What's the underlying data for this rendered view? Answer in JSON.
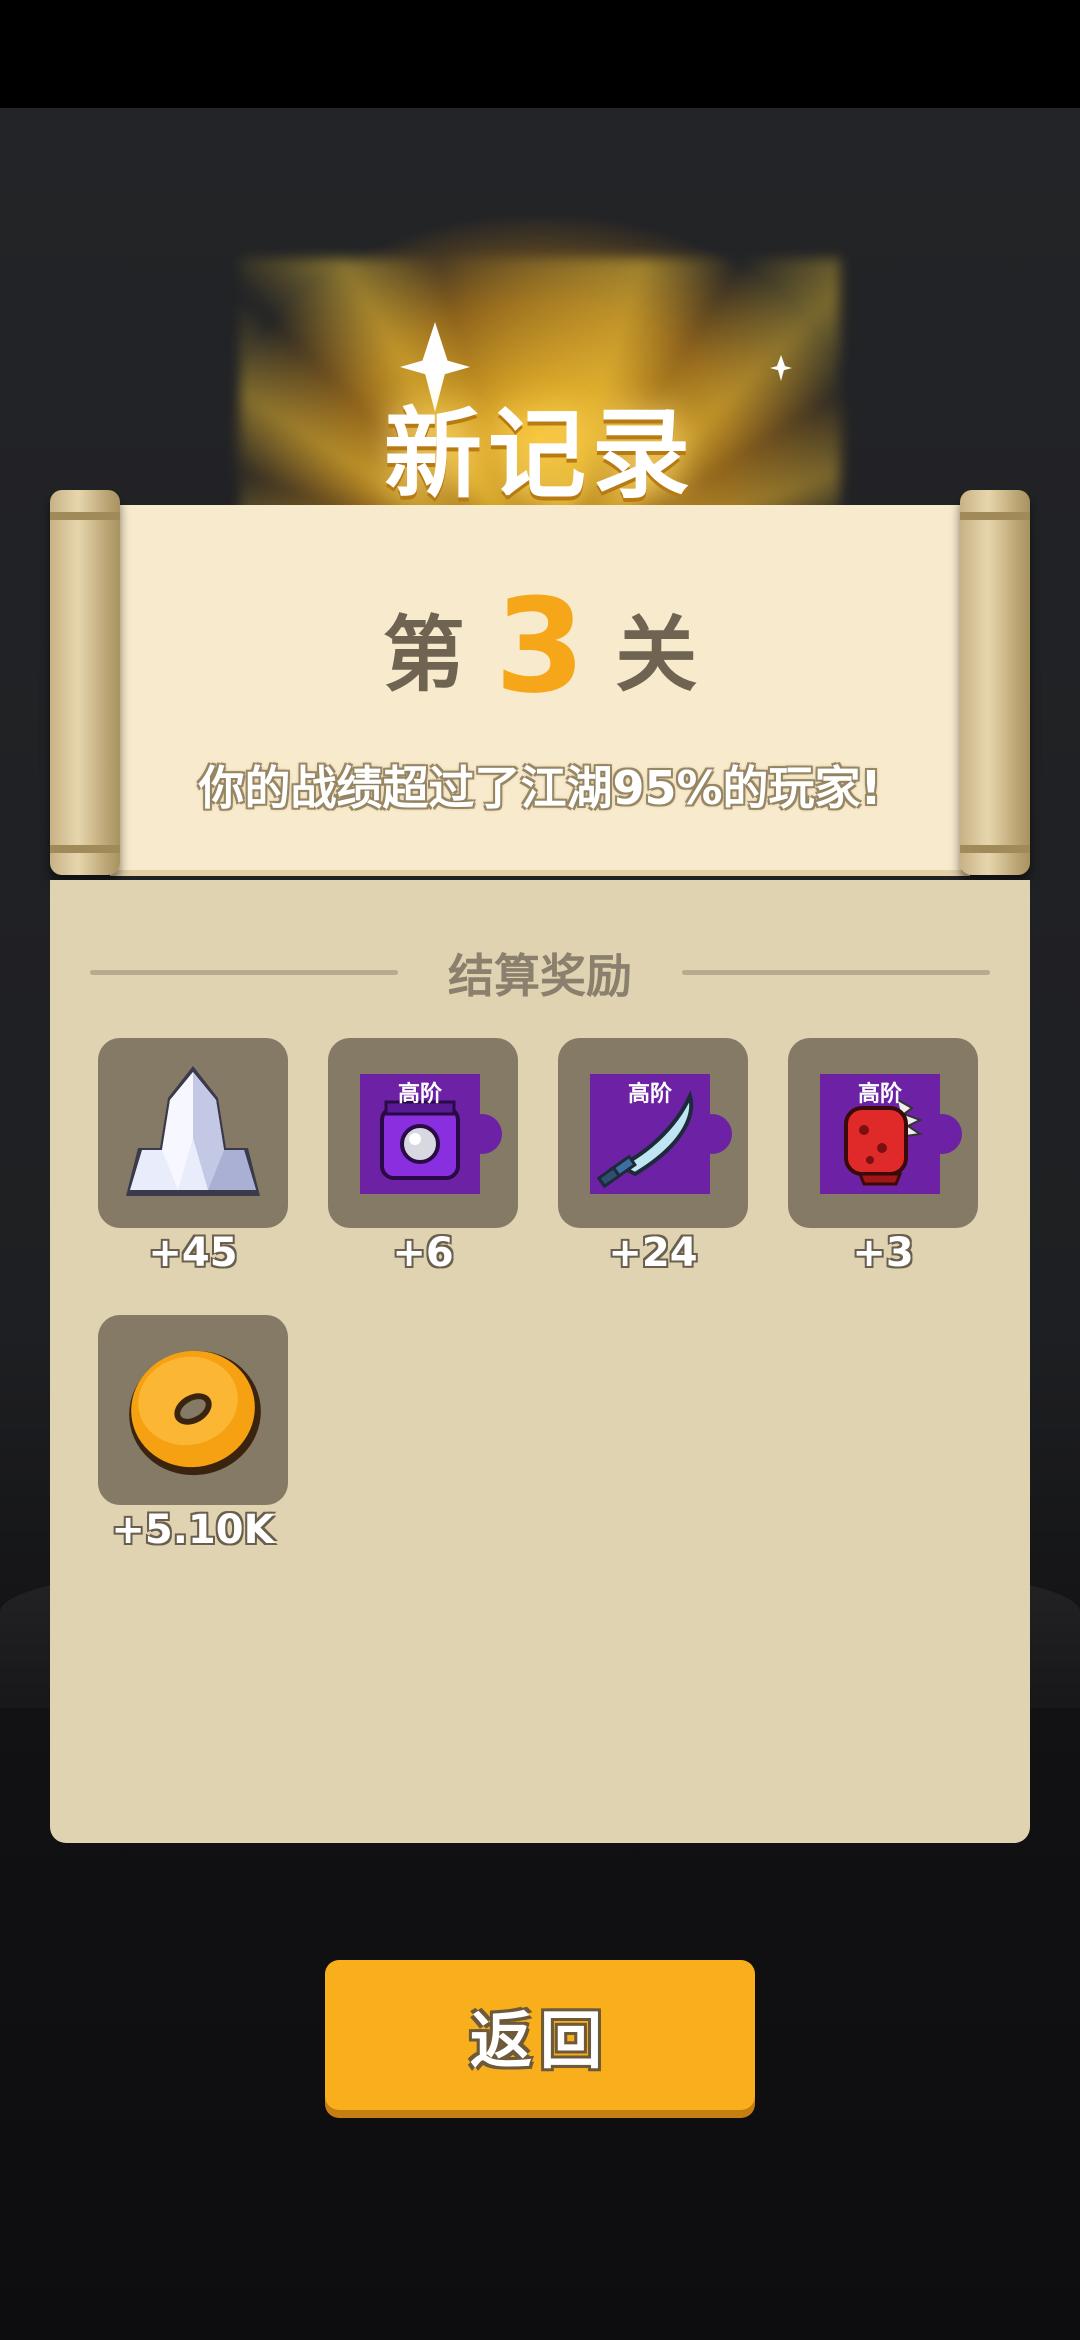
{
  "header": {
    "title": "新记录"
  },
  "stage": {
    "prefix": "第",
    "number": "3",
    "suffix": "关"
  },
  "record": {
    "text": "你的战绩超过了江湖95%的玩家!"
  },
  "rewards": {
    "section_title": "结算奖励",
    "items": [
      {
        "icon": "crystal-icon",
        "tier": "",
        "amount": "+45"
      },
      {
        "icon": "purple-armor-piece-icon",
        "tier": "高阶",
        "amount": "+6"
      },
      {
        "icon": "sword-piece-icon",
        "tier": "高阶",
        "amount": "+24"
      },
      {
        "icon": "red-gauntlet-piece-icon",
        "tier": "高阶",
        "amount": "+3"
      },
      {
        "icon": "gold-coin-icon",
        "tier": "",
        "amount": "+5.10K"
      }
    ]
  },
  "actions": {
    "return_label": "返回"
  },
  "colors": {
    "accent": "#f9ae1c",
    "stage_number": "#f5a619",
    "panel": "#e0d3b2",
    "scroll": "#f8eacc",
    "item_box": "#857a66",
    "piece_purple": "#6d22a5"
  }
}
